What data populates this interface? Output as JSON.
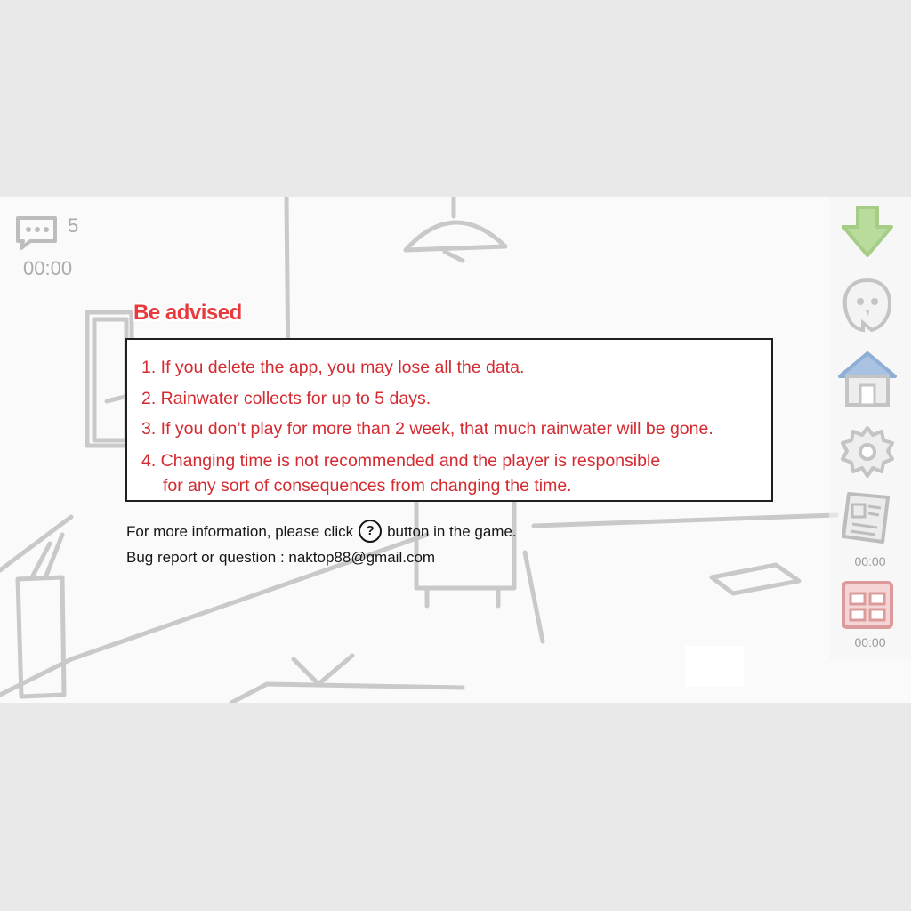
{
  "hud": {
    "message_icon": "speech-bubble-icon",
    "message_count": "5",
    "timer": "00:00"
  },
  "sidebar": {
    "buttons": [
      {
        "name": "green-arrow-icon",
        "color": "#9ed07a"
      },
      {
        "name": "ghost-face-icon"
      },
      {
        "name": "house-icon",
        "color": "#7ea8d8"
      },
      {
        "name": "gear-icon"
      },
      {
        "name": "newspaper-icon",
        "time": "00:00"
      },
      {
        "name": "calendar-icon",
        "color": "#e07a7a",
        "time": "00:00"
      }
    ]
  },
  "dialog": {
    "title": "Be advised",
    "items": [
      {
        "text": "1. If you delete the app, you may lose all the data."
      },
      {
        "text": "2. Rainwater collects for up to 5 days."
      },
      {
        "text": "3. If you don’t play for more than 2 week, that much rainwater will be gone."
      },
      {
        "text": "4. Changing time is not recommended and the player is responsible",
        "cont": "for any sort of consequences from changing the time."
      }
    ],
    "info_line1_before": "For more information, please click",
    "info_line1_after": "button in the game.",
    "help_symbol": "?",
    "info_line2": "Bug report or question : naktop88@gmail.com"
  },
  "colors": {
    "title_red": "#e8393d",
    "text_red": "#d42a30",
    "border": "#1f1f1f",
    "background": "#fafafa",
    "letterbox": "#e9e9e9"
  }
}
